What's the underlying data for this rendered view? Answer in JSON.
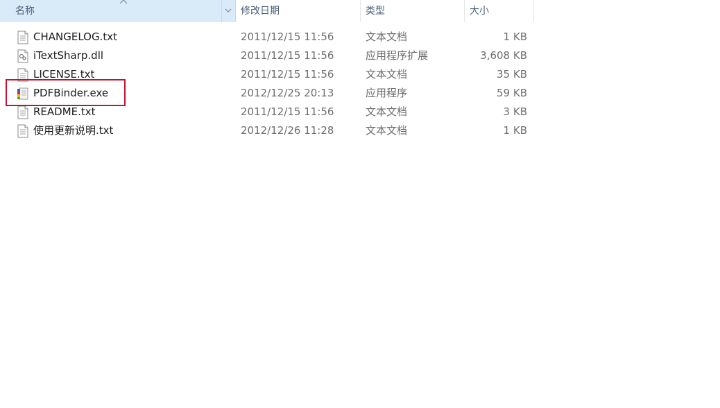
{
  "columns": {
    "name": "名称",
    "date": "修改日期",
    "type": "类型",
    "size": "大小"
  },
  "files": [
    {
      "name": "CHANGELOG.txt",
      "date": "2011/12/15 11:56",
      "type": "文本文档",
      "size": "1 KB",
      "icon": "text-file-icon"
    },
    {
      "name": "iTextSharp.dll",
      "date": "2011/12/15 11:56",
      "type": "应用程序扩展",
      "size": "3,608 KB",
      "icon": "dll-file-icon"
    },
    {
      "name": "LICENSE.txt",
      "date": "2011/12/15 11:56",
      "type": "文本文档",
      "size": "35 KB",
      "icon": "text-file-icon"
    },
    {
      "name": "PDFBinder.exe",
      "date": "2012/12/25 20:13",
      "type": "应用程序",
      "size": "59 KB",
      "icon": "pdfbinder-app-icon"
    },
    {
      "name": "README.txt",
      "date": "2011/12/15 11:56",
      "type": "文本文档",
      "size": "3 KB",
      "icon": "text-file-icon"
    },
    {
      "name": "使用更新说明.txt",
      "date": "2012/12/26 11:28",
      "type": "文本文档",
      "size": "1 KB",
      "icon": "text-file-icon"
    }
  ],
  "colors": {
    "header_selected": "#d9ebf9",
    "header_text": "#4c607a",
    "highlight_box": "#c8102e"
  }
}
